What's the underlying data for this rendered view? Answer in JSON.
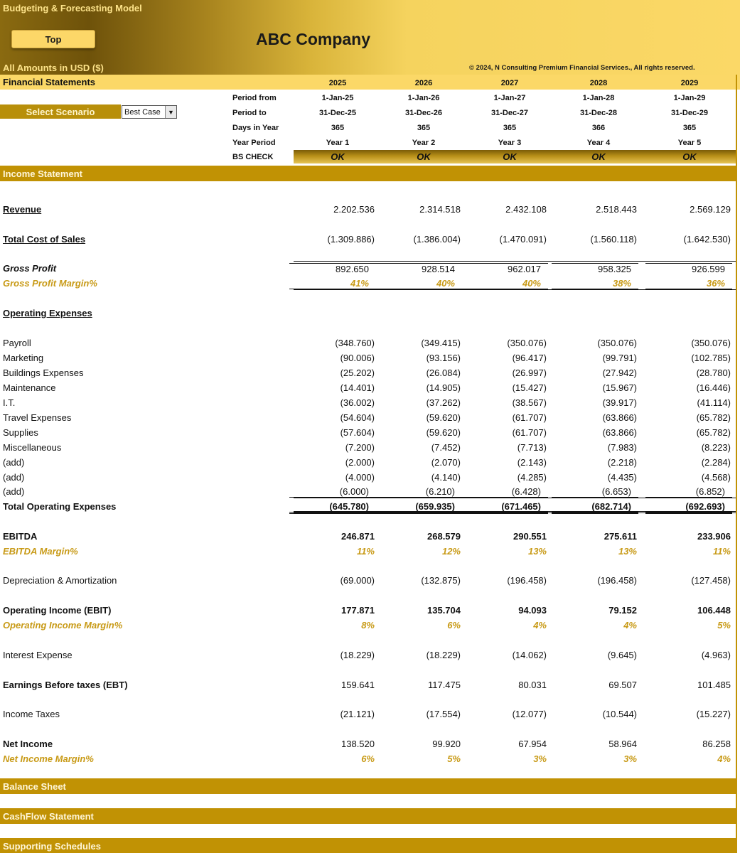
{
  "header": {
    "model_title": "Budgeting & Forecasting  Model",
    "top_button": "Top",
    "company": "ABC Company",
    "amounts": "All Amounts in  USD ($)",
    "copyright": "© 2024, N Consulting Premium Financial Services., All rights reserved."
  },
  "fs_label": "Financial Statements",
  "years": [
    "2025",
    "2026",
    "2027",
    "2028",
    "2029"
  ],
  "scenario": {
    "label": "Select Scenario",
    "value": "Best Case"
  },
  "period_rows": [
    {
      "label": "Period from",
      "values": [
        "1-Jan-25",
        "1-Jan-26",
        "1-Jan-27",
        "1-Jan-28",
        "1-Jan-29"
      ]
    },
    {
      "label": "Period to",
      "values": [
        "31-Dec-25",
        "31-Dec-26",
        "31-Dec-27",
        "31-Dec-28",
        "31-Dec-29"
      ]
    },
    {
      "label": "Days in Year",
      "values": [
        "365",
        "365",
        "365",
        "366",
        "365"
      ]
    },
    {
      "label": "Year Period",
      "values": [
        "Year 1",
        "Year 2",
        "Year 3",
        "Year 4",
        "Year 5"
      ]
    }
  ],
  "bs_check": {
    "label": "BS CHECK",
    "values": [
      "OK",
      "OK",
      "OK",
      "OK",
      "OK"
    ]
  },
  "sections": {
    "income": "Income Statement",
    "balance": "Balance Sheet",
    "cashflow": "CashFlow Statement",
    "supporting": "Supporting Schedules"
  },
  "income": {
    "revenue": {
      "label": "Revenue",
      "values": [
        "2.202.536",
        "2.314.518",
        "2.432.108",
        "2.518.443",
        "2.569.129"
      ]
    },
    "cos": {
      "label": "Total Cost of Sales",
      "values": [
        "(1.309.886)",
        "(1.386.004)",
        "(1.470.091)",
        "(1.560.118)",
        "(1.642.530)"
      ]
    },
    "gp": {
      "label": "Gross Profit",
      "values": [
        "892.650",
        "928.514",
        "962.017",
        "958.325",
        "926.599"
      ]
    },
    "gpm": {
      "label": "Gross Profit Margin%",
      "values": [
        "41%",
        "40%",
        "40%",
        "38%",
        "36%"
      ]
    },
    "opex_title": "Operating Expenses",
    "opex": [
      {
        "label": "Payroll",
        "values": [
          "(348.760)",
          "(349.415)",
          "(350.076)",
          "(350.076)",
          "(350.076)"
        ]
      },
      {
        "label": "Marketing",
        "values": [
          "(90.006)",
          "(93.156)",
          "(96.417)",
          "(99.791)",
          "(102.785)"
        ]
      },
      {
        "label": "Buildings Expenses",
        "values": [
          "(25.202)",
          "(26.084)",
          "(26.997)",
          "(27.942)",
          "(28.780)"
        ]
      },
      {
        "label": "Maintenance",
        "values": [
          "(14.401)",
          "(14.905)",
          "(15.427)",
          "(15.967)",
          "(16.446)"
        ]
      },
      {
        "label": "I.T.",
        "values": [
          "(36.002)",
          "(37.262)",
          "(38.567)",
          "(39.917)",
          "(41.114)"
        ]
      },
      {
        "label": "Travel Expenses",
        "values": [
          "(54.604)",
          "(59.620)",
          "(61.707)",
          "(63.866)",
          "(65.782)"
        ]
      },
      {
        "label": "Supplies",
        "values": [
          "(57.604)",
          "(59.620)",
          "(61.707)",
          "(63.866)",
          "(65.782)"
        ]
      },
      {
        "label": "Miscellaneous",
        "values": [
          "(7.200)",
          "(7.452)",
          "(7.713)",
          "(7.983)",
          "(8.223)"
        ]
      },
      {
        "label": "(add)",
        "values": [
          "(2.000)",
          "(2.070)",
          "(2.143)",
          "(2.218)",
          "(2.284)"
        ]
      },
      {
        "label": "(add)",
        "values": [
          "(4.000)",
          "(4.140)",
          "(4.285)",
          "(4.435)",
          "(4.568)"
        ]
      },
      {
        "label": "(add)",
        "values": [
          "(6.000)",
          "(6.210)",
          "(6.428)",
          "(6.653)",
          "(6.852)"
        ]
      }
    ],
    "total_opex": {
      "label": "Total Operating Expenses",
      "values": [
        "(645.780)",
        "(659.935)",
        "(671.465)",
        "(682.714)",
        "(692.693)"
      ]
    },
    "ebitda": {
      "label": "EBITDA",
      "values": [
        "246.871",
        "268.579",
        "290.551",
        "275.611",
        "233.906"
      ]
    },
    "ebitda_m": {
      "label": "EBITDA Margin%",
      "values": [
        "11%",
        "12%",
        "13%",
        "13%",
        "11%"
      ]
    },
    "da": {
      "label": "Depreciation & Amortization",
      "values": [
        "(69.000)",
        "(132.875)",
        "(196.458)",
        "(196.458)",
        "(127.458)"
      ]
    },
    "ebit": {
      "label": "Operating Income (EBIT)",
      "values": [
        "177.871",
        "135.704",
        "94.093",
        "79.152",
        "106.448"
      ]
    },
    "ebit_m": {
      "label": "Operating Income Margin%",
      "values": [
        "8%",
        "6%",
        "4%",
        "4%",
        "5%"
      ]
    },
    "interest": {
      "label": "Interest Expense",
      "values": [
        "(18.229)",
        "(18.229)",
        "(14.062)",
        "(9.645)",
        "(4.963)"
      ]
    },
    "ebt": {
      "label": "Earnings Before taxes (EBT)",
      "values": [
        "159.641",
        "117.475",
        "80.031",
        "69.507",
        "101.485"
      ]
    },
    "taxes": {
      "label": "Income Taxes",
      "values": [
        "(21.121)",
        "(17.554)",
        "(12.077)",
        "(10.544)",
        "(15.227)"
      ]
    },
    "ni": {
      "label": "Net Income",
      "values": [
        "138.520",
        "99.920",
        "67.954",
        "58.964",
        "86.258"
      ]
    },
    "ni_m": {
      "label": "Net Income Margin%",
      "values": [
        "6%",
        "5%",
        "3%",
        "3%",
        "4%"
      ]
    }
  }
}
